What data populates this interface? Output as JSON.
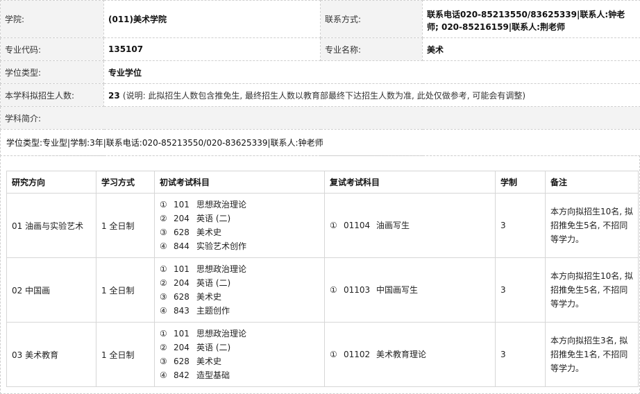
{
  "info": {
    "college_label": "学院:",
    "college_value": "(011)美术学院",
    "contact_label": "联系方式:",
    "contact_line1": "联系电话020-85213550/83625339|联系人:钟老",
    "contact_line2": "师; 020-85216159|联系人:荆老师",
    "major_code_label": "专业代码:",
    "major_code_value": "135107",
    "major_name_label": "专业名称:",
    "major_name_value": "美术",
    "degree_type_label": "学位类型:",
    "degree_type_value": "专业学位",
    "enroll_label": "本学科拟招生人数:",
    "enroll_value": "23",
    "enroll_note": "(说明: 此拟招生人数包含推免生, 最终招生人数以教育部最终下达招生人数为准, 此处仅做参考, 可能会有调整)",
    "intro_label": "学科简介:",
    "intro_text": "学位类型:专业型|学制:3年|联系电话:020-85213550/020-83625339|联系人:钟老师"
  },
  "directions": {
    "headers": [
      "研究方向",
      "学习方式",
      "初试考试科目",
      "复试考试科目",
      "学制",
      "备注"
    ],
    "rows": [
      {
        "direction": "01 油画与实验艺术",
        "mode": "1 全日制",
        "exams": [
          {
            "num": "①",
            "code": "101",
            "name": "思想政治理论"
          },
          {
            "num": "②",
            "code": "204",
            "name": "英语 (二)"
          },
          {
            "num": "③",
            "code": "628",
            "name": "美术史"
          },
          {
            "num": "④",
            "code": "844",
            "name": "实验艺术创作"
          }
        ],
        "retest": {
          "num": "①",
          "code": "01104",
          "name": "油画写生"
        },
        "years": "3",
        "remark": "本方向拟招生10名, 拟招推免生5名, 不招同等学力。"
      },
      {
        "direction": "02 中国画",
        "mode": "1 全日制",
        "exams": [
          {
            "num": "①",
            "code": "101",
            "name": "思想政治理论"
          },
          {
            "num": "②",
            "code": "204",
            "name": "英语 (二)"
          },
          {
            "num": "③",
            "code": "628",
            "name": "美术史"
          },
          {
            "num": "④",
            "code": "843",
            "name": "主题创作"
          }
        ],
        "retest": {
          "num": "①",
          "code": "01103",
          "name": "中国画写生"
        },
        "years": "3",
        "remark": "本方向拟招生10名, 拟招推免生5名, 不招同等学力。"
      },
      {
        "direction": "03 美术教育",
        "mode": "1 全日制",
        "exams": [
          {
            "num": "①",
            "code": "101",
            "name": "思想政治理论"
          },
          {
            "num": "②",
            "code": "204",
            "name": "英语 (二)"
          },
          {
            "num": "③",
            "code": "628",
            "name": "美术史"
          },
          {
            "num": "④",
            "code": "842",
            "name": "造型基础"
          }
        ],
        "retest": {
          "num": "①",
          "code": "01102",
          "name": "美术教育理论"
        },
        "years": "3",
        "remark": "本方向拟招生3名, 拟招推免生1名, 不招同等学力。"
      }
    ]
  }
}
